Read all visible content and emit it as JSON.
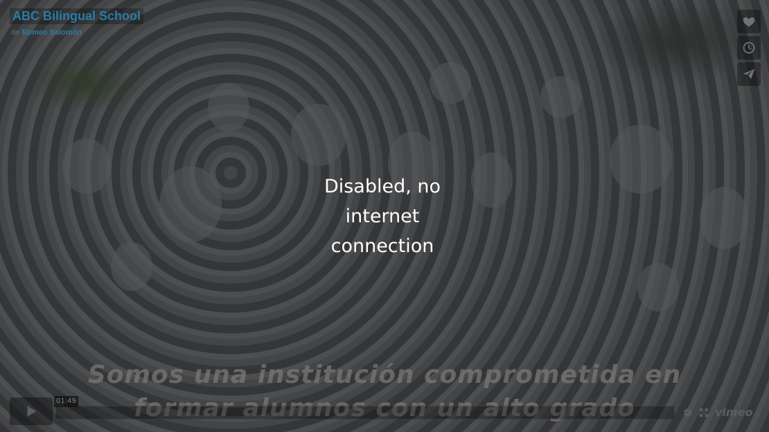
{
  "video": {
    "title": "ABC Bilingual School",
    "byline_prefix": "de",
    "author": "Romeo Salomón"
  },
  "actions": {
    "like": "heart-icon",
    "watch_later": "clock-icon",
    "share": "paper-plane-icon"
  },
  "status_message": "Disabled, no internet connection",
  "caption": {
    "line1": "Somos una institución comprometida en",
    "line2": "formar alumnos con un alto grado"
  },
  "controls": {
    "time": "01:49",
    "progress": 0,
    "settings_icon": "gear-icon",
    "fullscreen_icon": "fullscreen-icon",
    "brand": "vimeo"
  },
  "colors": {
    "title": "#2b7ba6",
    "overlay": "rgba(40,40,40,0.62)",
    "controls": "#5a5e63"
  }
}
